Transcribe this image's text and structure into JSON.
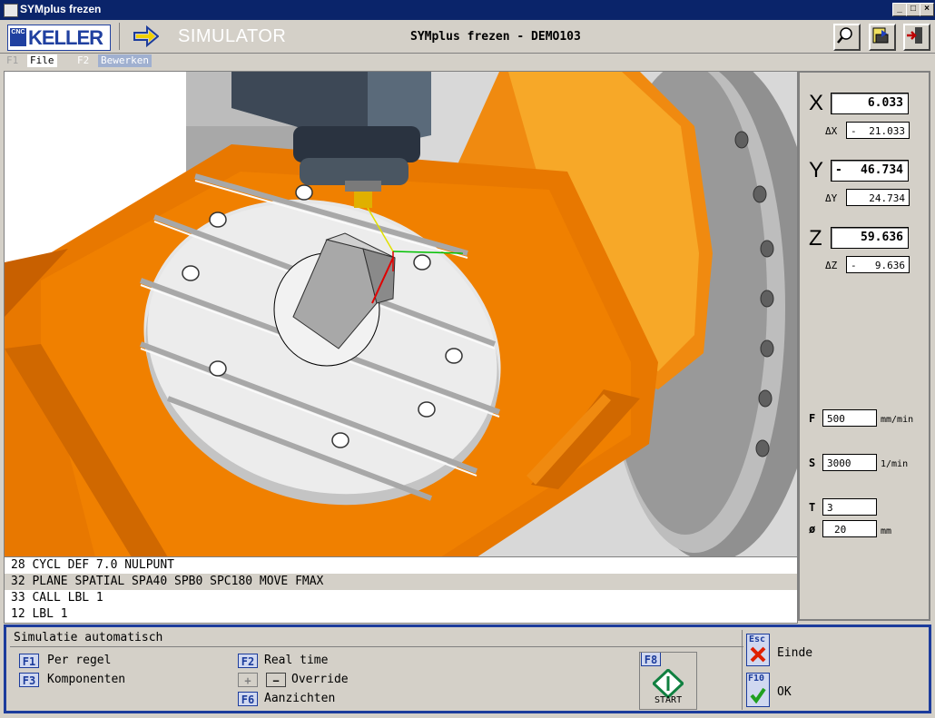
{
  "window": {
    "title": "SYMplus frezen",
    "controls": [
      "_",
      "□",
      "×"
    ]
  },
  "header": {
    "logo": {
      "badge": "CNC",
      "name": "KELLER"
    },
    "mode": "SIMULATOR",
    "program_title": "SYMplus frezen - DEMO103",
    "icons": [
      "search-icon",
      "load-icon",
      "exit-icon"
    ]
  },
  "menubar": {
    "items": [
      {
        "key": "F1",
        "label": "File"
      },
      {
        "key": "F2",
        "label": "Bewerken"
      }
    ]
  },
  "program": {
    "lines": [
      "28 CYCL DEF 7.0 NULPUNT",
      "32 PLANE SPATIAL SPA40 SPB0 SPC180 MOVE FMAX",
      "33 CALL LBL 1",
      "12 LBL 1"
    ],
    "selected_index": 1
  },
  "position": {
    "X": {
      "label": "X",
      "value": "6.033",
      "delta_label": "ΔX",
      "delta_sign": "-",
      "delta": "21.033"
    },
    "Y": {
      "label": "Y",
      "sign": "-",
      "value": "46.734",
      "delta_label": "ΔY",
      "delta": "24.734"
    },
    "Z": {
      "label": "Z",
      "value": "59.636",
      "delta_label": "ΔZ",
      "delta_sign": "-",
      "delta": "9.636"
    }
  },
  "params": {
    "F": {
      "label": "F",
      "value": "500",
      "unit": "mm/min"
    },
    "S": {
      "label": "S",
      "value": "3000",
      "unit": "1/min"
    },
    "T": {
      "label": "T",
      "value": "3"
    },
    "D": {
      "label": "ø",
      "value": "20",
      "unit": "mm"
    }
  },
  "softkeys": {
    "mode_title": "Simulatie automatisch",
    "f1": {
      "key": "F1",
      "label": "Per regel"
    },
    "f3": {
      "key": "F3",
      "label": "Komponenten"
    },
    "f2": {
      "key": "F2",
      "label": "Real time"
    },
    "override": {
      "plus": "+",
      "minus": "−",
      "label": "Override"
    },
    "f6": {
      "key": "F6",
      "label": "Aanzichten"
    },
    "f8": {
      "key": "F8",
      "label": "START"
    },
    "esc": {
      "key": "Esc",
      "label": "Einde"
    },
    "f10": {
      "key": "F10",
      "label": "OK"
    }
  },
  "colors": {
    "accent": "#1c3c9c",
    "machine_orange": "#f07800",
    "title_bar": "#0a246a"
  }
}
